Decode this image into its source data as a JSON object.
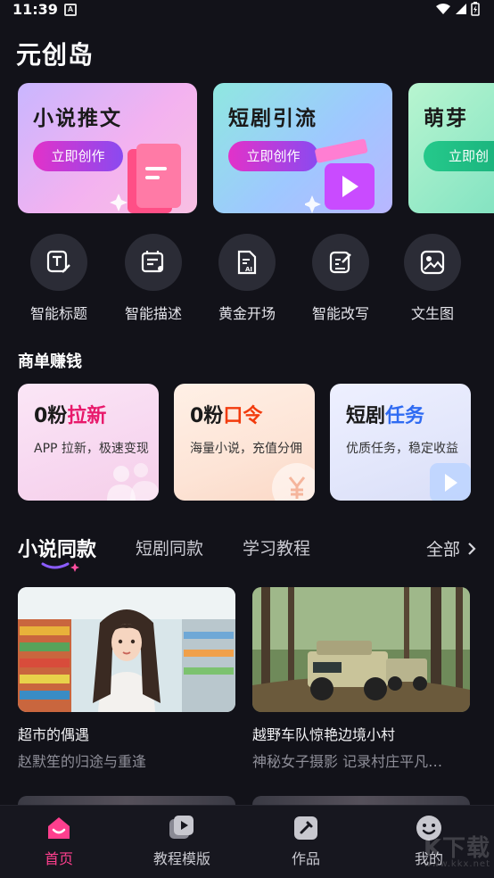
{
  "status_bar": {
    "time": "11:39",
    "notification_icon": "a-icon"
  },
  "app": {
    "title": "元创岛"
  },
  "banners": [
    {
      "title": "小说推文",
      "button": "立即创作",
      "icon": "book-icon"
    },
    {
      "title": "短剧引流",
      "button": "立即创作",
      "icon": "clapperboard-icon"
    },
    {
      "title": "萌芽",
      "button": "立即创",
      "icon": "sprout-icon"
    }
  ],
  "quick_actions": [
    {
      "label": "智能标题",
      "icon": "title-edit-icon"
    },
    {
      "label": "智能描述",
      "icon": "description-icon"
    },
    {
      "label": "黄金开场",
      "icon": "ai-doc-icon"
    },
    {
      "label": "智能改写",
      "icon": "rewrite-icon"
    },
    {
      "label": "文生图",
      "icon": "image-icon"
    }
  ],
  "earn": {
    "title": "商单赚钱",
    "cards": [
      {
        "prefix": "0粉",
        "highlight": "拉新",
        "desc": "APP 拉新，极速变现",
        "color": "#e8196b"
      },
      {
        "prefix": "0粉",
        "highlight": "口令",
        "desc": "海量小说，充值分佣",
        "color": "#f23b0d"
      },
      {
        "prefix": "短剧",
        "highlight": "任务",
        "desc": "优质任务，稳定收益",
        "color": "#2f6bf2"
      }
    ]
  },
  "tabs": {
    "items": [
      "小说同款",
      "短剧同款",
      "学习教程"
    ],
    "active_index": 0,
    "all_label": "全部"
  },
  "cards": [
    {
      "title": "超市的偶遇",
      "subtitle": "赵默笙的归途与重逢"
    },
    {
      "title": "越野车队惊艳边境小村",
      "subtitle": "神秘女子摄影 记录村庄平凡…"
    }
  ],
  "bottom_nav": [
    {
      "label": "首页",
      "icon": "home-icon",
      "active": true
    },
    {
      "label": "教程模版",
      "icon": "play-stack-icon",
      "active": false
    },
    {
      "label": "作品",
      "icon": "works-icon",
      "active": false
    },
    {
      "label": "我的",
      "icon": "profile-icon",
      "active": false
    }
  ],
  "watermark": {
    "text": "K下载",
    "url": "www.kkx.net"
  }
}
